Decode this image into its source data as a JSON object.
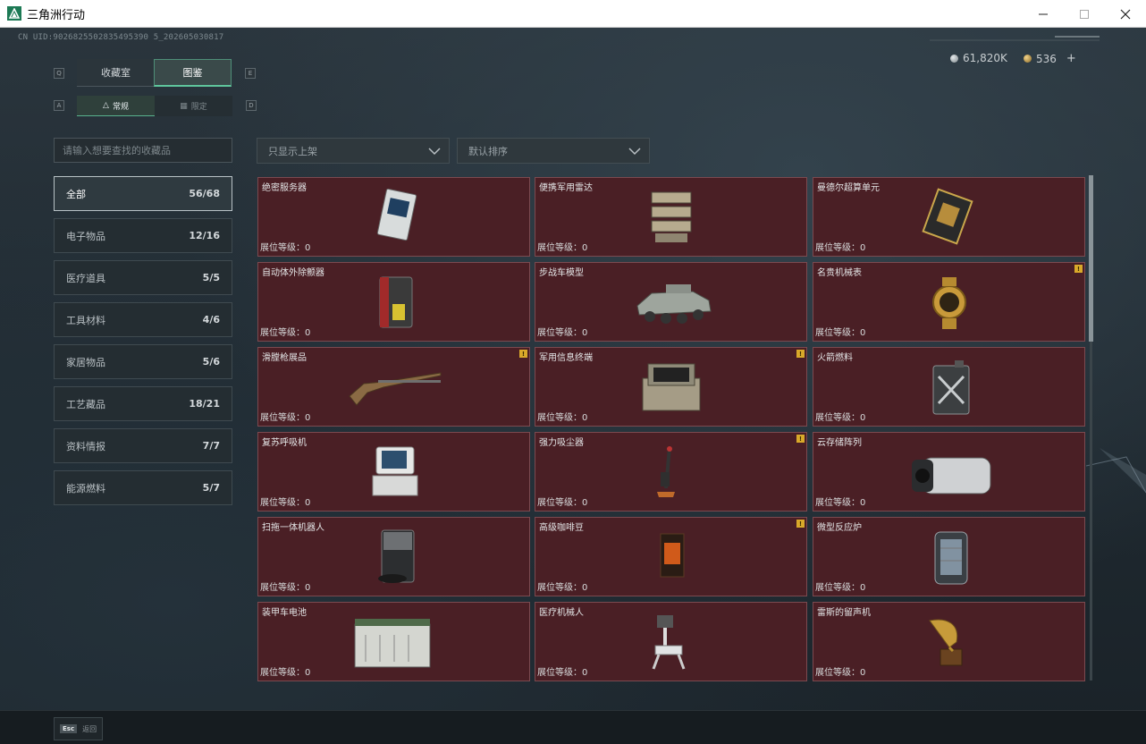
{
  "window": {
    "title": "三角洲行动",
    "minimize_icon": "minimize-icon",
    "maximize_icon": "maximize-icon",
    "close_icon": "close-icon"
  },
  "header": {
    "uid": "CN UID:9026825502835495390 5_202605030817",
    "currency": [
      {
        "icon": "silver-coin-icon",
        "value": "61,820K",
        "color": "#b8c0c4"
      },
      {
        "icon": "gold-coin-icon",
        "value": "536",
        "color": "#c9a860"
      }
    ],
    "add_label": "+"
  },
  "tabs": {
    "left_key": "Q",
    "right_key": "E",
    "items": [
      {
        "label": "收藏室",
        "active": false
      },
      {
        "label": "图鉴",
        "active": true
      }
    ]
  },
  "subtabs": {
    "left_key": "A",
    "right_key": "D",
    "items": [
      {
        "label": "常规",
        "icon": "flame-icon",
        "active": true
      },
      {
        "label": "限定",
        "icon": "limited-icon",
        "active": false
      }
    ]
  },
  "search": {
    "placeholder": "请输入想要查找的收藏品"
  },
  "filters": {
    "shelf": "只显示上架",
    "sort": "默认排序"
  },
  "categories": [
    {
      "label": "全部",
      "count": "56/68",
      "active": true
    },
    {
      "label": "电子物品",
      "count": "12/16",
      "active": false
    },
    {
      "label": "医疗道具",
      "count": "5/5",
      "active": false
    },
    {
      "label": "工具材料",
      "count": "4/6",
      "active": false
    },
    {
      "label": "家居物品",
      "count": "5/6",
      "active": false
    },
    {
      "label": "工艺藏品",
      "count": "18/21",
      "active": false
    },
    {
      "label": "资料情报",
      "count": "7/7",
      "active": false
    },
    {
      "label": "能源燃料",
      "count": "5/7",
      "active": false
    }
  ],
  "level_label": "展位等级：",
  "items": [
    {
      "name": "绝密服务器",
      "level": "0",
      "badge": false,
      "icon": "server-icon"
    },
    {
      "name": "便携军用雷达",
      "level": "0",
      "badge": false,
      "icon": "radar-icon"
    },
    {
      "name": "曼德尔超算单元",
      "level": "0",
      "badge": false,
      "icon": "cpu-icon"
    },
    {
      "name": "自动体外除颤器",
      "level": "0",
      "badge": false,
      "icon": "defibrillator-icon"
    },
    {
      "name": "步战车模型",
      "level": "0",
      "badge": false,
      "icon": "ifv-model-icon"
    },
    {
      "name": "名贵机械表",
      "level": "0",
      "badge": true,
      "icon": "watch-icon"
    },
    {
      "name": "滑膛枪展品",
      "level": "0",
      "badge": true,
      "icon": "musket-icon"
    },
    {
      "name": "军用信息终端",
      "level": "0",
      "badge": true,
      "icon": "terminal-icon"
    },
    {
      "name": "火箭燃料",
      "level": "0",
      "badge": false,
      "icon": "fuel-can-icon"
    },
    {
      "name": "复苏呼吸机",
      "level": "0",
      "badge": false,
      "icon": "ventilator-icon"
    },
    {
      "name": "强力吸尘器",
      "level": "0",
      "badge": true,
      "icon": "vacuum-icon"
    },
    {
      "name": "云存储阵列",
      "level": "0",
      "badge": false,
      "icon": "storage-array-icon"
    },
    {
      "name": "扫拖一体机器人",
      "level": "0",
      "badge": false,
      "icon": "mop-robot-icon"
    },
    {
      "name": "高级咖啡豆",
      "level": "0",
      "badge": true,
      "icon": "coffee-bag-icon"
    },
    {
      "name": "微型反应炉",
      "level": "0",
      "badge": false,
      "icon": "reactor-icon"
    },
    {
      "name": "装甲车电池",
      "level": "0",
      "badge": false,
      "icon": "battery-icon"
    },
    {
      "name": "医疗机械人",
      "level": "0",
      "badge": false,
      "icon": "medical-robot-icon"
    },
    {
      "name": "雷斯的留声机",
      "level": "0",
      "badge": false,
      "icon": "gramophone-icon"
    }
  ],
  "badge_text": "!",
  "footer": {
    "esc_key": "Esc",
    "back_label": "返回"
  }
}
